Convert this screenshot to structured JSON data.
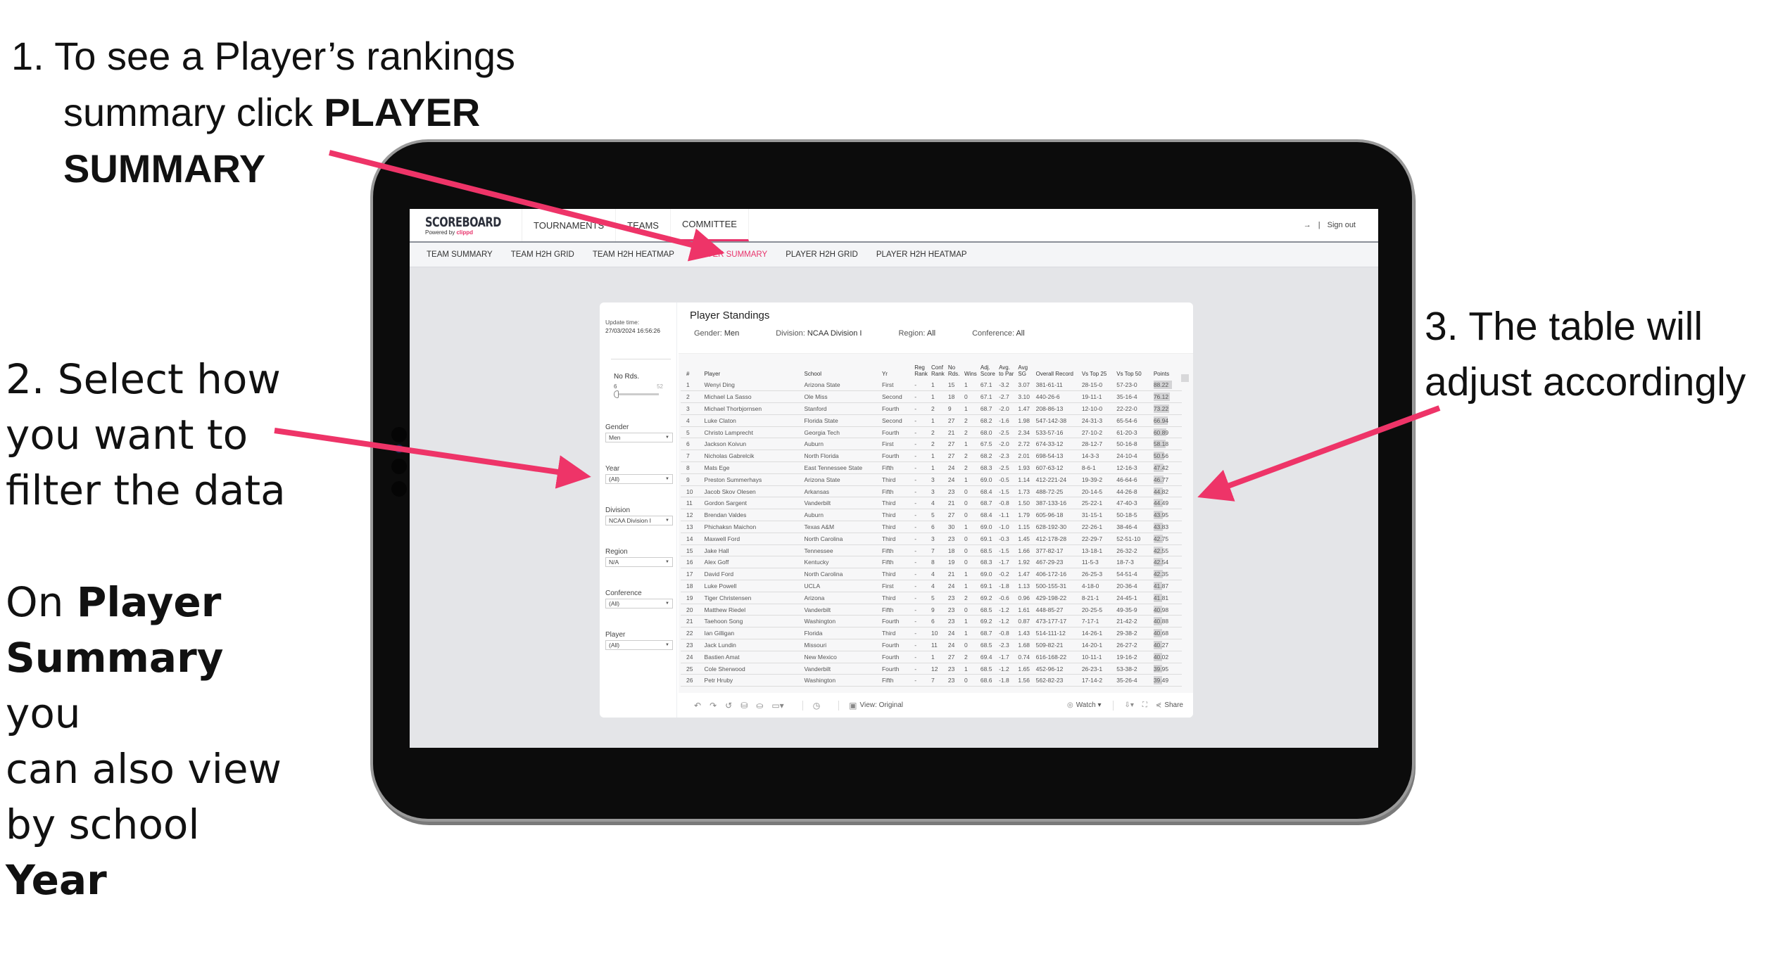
{
  "annotations": {
    "step1": {
      "prefix": "1. To see a Player’s rankings",
      "line2": "summary click ",
      "bold1": "PLAYER",
      "bold2": "SUMMARY"
    },
    "step2": {
      "line1": "2. Select how",
      "line2": "you want to",
      "line3": "filter the data",
      "p1": "On ",
      "b1": "Player",
      "b2": "Summary",
      "p2": " you",
      "line6": "can also view",
      "p3": "by school ",
      "b3": "Year"
    },
    "step3": {
      "line1": "3. The table will",
      "line2": "adjust accordingly"
    },
    "arrow_color": "#ee3468"
  },
  "app": {
    "brand": {
      "title": "SCOREBOARD",
      "sub_prefix": "Powered by ",
      "sub_brand": "clippd"
    },
    "topnav": [
      "TOURNAMENTS",
      "TEAMS",
      "COMMITTEE"
    ],
    "topnav_right": {
      "icon": "→",
      "sep": "|",
      "signout": "Sign out"
    },
    "subnav": [
      "TEAM SUMMARY",
      "TEAM H2H GRID",
      "TEAM H2H HEATMAP",
      "PLAYER SUMMARY",
      "PLAYER H2H GRID",
      "PLAYER H2H HEATMAP"
    ],
    "subnav_active": "PLAYER SUMMARY",
    "accent_color": "#e8336b"
  },
  "sidebar": {
    "update_label": "Update time:",
    "update_value": "27/03/2024 16:56:26",
    "slider": {
      "label": "No Rds.",
      "min": "6",
      "max": "52",
      "value_fraction": 0.0
    },
    "filters": [
      {
        "label": "Gender",
        "value": "Men"
      },
      {
        "label": "Year",
        "value": "(All)"
      },
      {
        "label": "Division",
        "value": "NCAA Division I"
      },
      {
        "label": "Region",
        "value": "N/A"
      },
      {
        "label": "Conference",
        "value": "(All)"
      },
      {
        "label": "Player",
        "value": "(All)"
      }
    ]
  },
  "main": {
    "title": "Player Standings",
    "summary": [
      {
        "key": "Gender: ",
        "value": "Men"
      },
      {
        "key": "Division: ",
        "value": "NCAA Division I"
      },
      {
        "key": "Region: ",
        "value": "All"
      },
      {
        "key": "Conference: ",
        "value": "All"
      }
    ],
    "columns": [
      "#",
      "Player",
      "School",
      "Yr",
      "Reg Rank",
      "Conf Rank",
      "No Rds.",
      "Wins",
      "Adj. Score",
      "Avg. to Par",
      "Avg SG",
      "Overall Record",
      "Vs Top 25",
      "Vs Top 50",
      "Points"
    ],
    "rows": [
      [
        "1",
        "Wenyi Ding",
        "Arizona State",
        "First",
        "-",
        "1",
        "15",
        "1",
        "67.1",
        "-3.2",
        "3.07",
        "381-61-11",
        "28-15-0",
        "57-23-0",
        "88.22"
      ],
      [
        "2",
        "Michael La Sasso",
        "Ole Miss",
        "Second",
        "-",
        "1",
        "18",
        "0",
        "67.1",
        "-2.7",
        "3.10",
        "440-26-6",
        "19-11-1",
        "35-16-4",
        "76.12"
      ],
      [
        "3",
        "Michael Thorbjornsen",
        "Stanford",
        "Fourth",
        "-",
        "2",
        "9",
        "1",
        "68.7",
        "-2.0",
        "1.47",
        "208-86-13",
        "12-10-0",
        "22-22-0",
        "73.22"
      ],
      [
        "4",
        "Luke Claton",
        "Florida State",
        "Second",
        "-",
        "1",
        "27",
        "2",
        "68.2",
        "-1.6",
        "1.98",
        "547-142-38",
        "24-31-3",
        "65-54-6",
        "66.94"
      ],
      [
        "5",
        "Christo Lamprecht",
        "Georgia Tech",
        "Fourth",
        "-",
        "2",
        "21",
        "2",
        "68.0",
        "-2.5",
        "2.34",
        "533-57-16",
        "27-10-2",
        "61-20-3",
        "60.89"
      ],
      [
        "6",
        "Jackson Koivun",
        "Auburn",
        "First",
        "-",
        "2",
        "27",
        "1",
        "67.5",
        "-2.0",
        "2.72",
        "674-33-12",
        "28-12-7",
        "50-16-8",
        "58.18"
      ],
      [
        "7",
        "Nicholas Gabrelcik",
        "North Florida",
        "Fourth",
        "-",
        "1",
        "27",
        "2",
        "68.2",
        "-2.3",
        "2.01",
        "698-54-13",
        "14-3-3",
        "24-10-4",
        "50.56"
      ],
      [
        "8",
        "Mats Ege",
        "East Tennessee State",
        "Fifth",
        "-",
        "1",
        "24",
        "2",
        "68.3",
        "-2.5",
        "1.93",
        "607-63-12",
        "8-6-1",
        "12-16-3",
        "47.42"
      ],
      [
        "9",
        "Preston Summerhays",
        "Arizona State",
        "Third",
        "-",
        "3",
        "24",
        "1",
        "69.0",
        "-0.5",
        "1.14",
        "412-221-24",
        "19-39-2",
        "46-64-6",
        "46.77"
      ],
      [
        "10",
        "Jacob Skov Olesen",
        "Arkansas",
        "Fifth",
        "-",
        "3",
        "23",
        "0",
        "68.4",
        "-1.5",
        "1.73",
        "488-72-25",
        "20-14-5",
        "44-26-8",
        "44.82"
      ],
      [
        "11",
        "Gordon Sargent",
        "Vanderbilt",
        "Third",
        "-",
        "4",
        "21",
        "0",
        "68.7",
        "-0.8",
        "1.50",
        "387-133-16",
        "25-22-1",
        "47-40-3",
        "44.49"
      ],
      [
        "12",
        "Brendan Valdes",
        "Auburn",
        "Third",
        "-",
        "5",
        "27",
        "0",
        "68.4",
        "-1.1",
        "1.79",
        "605-96-18",
        "31-15-1",
        "50-18-5",
        "43.95"
      ],
      [
        "13",
        "Phichaksn Maichon",
        "Texas A&M",
        "Third",
        "-",
        "6",
        "30",
        "1",
        "69.0",
        "-1.0",
        "1.15",
        "628-192-30",
        "22-26-1",
        "38-46-4",
        "43.83"
      ],
      [
        "14",
        "Maxwell Ford",
        "North Carolina",
        "Third",
        "-",
        "3",
        "23",
        "0",
        "69.1",
        "-0.3",
        "1.45",
        "412-178-28",
        "22-29-7",
        "52-51-10",
        "42.75"
      ],
      [
        "15",
        "Jake Hall",
        "Tennessee",
        "Fifth",
        "-",
        "7",
        "18",
        "0",
        "68.5",
        "-1.5",
        "1.66",
        "377-82-17",
        "13-18-1",
        "26-32-2",
        "42.55"
      ],
      [
        "16",
        "Alex Goff",
        "Kentucky",
        "Fifth",
        "-",
        "8",
        "19",
        "0",
        "68.3",
        "-1.7",
        "1.92",
        "467-29-23",
        "11-5-3",
        "18-7-3",
        "42.54"
      ],
      [
        "17",
        "David Ford",
        "North Carolina",
        "Third",
        "-",
        "4",
        "21",
        "1",
        "69.0",
        "-0.2",
        "1.47",
        "406-172-16",
        "26-25-3",
        "54-51-4",
        "42.35"
      ],
      [
        "18",
        "Luke Powell",
        "UCLA",
        "First",
        "-",
        "4",
        "24",
        "1",
        "69.1",
        "-1.8",
        "1.13",
        "500-155-31",
        "4-18-0",
        "20-36-4",
        "41.87"
      ],
      [
        "19",
        "Tiger Christensen",
        "Arizona",
        "Third",
        "-",
        "5",
        "23",
        "2",
        "69.2",
        "-0.6",
        "0.96",
        "429-198-22",
        "8-21-1",
        "24-45-1",
        "41.81"
      ],
      [
        "20",
        "Matthew Riedel",
        "Vanderbilt",
        "Fifth",
        "-",
        "9",
        "23",
        "0",
        "68.5",
        "-1.2",
        "1.61",
        "448-85-27",
        "20-25-5",
        "49-35-9",
        "40.98"
      ],
      [
        "21",
        "Taehoon Song",
        "Washington",
        "Fourth",
        "-",
        "6",
        "23",
        "1",
        "69.2",
        "-1.2",
        "0.87",
        "473-177-17",
        "7-17-1",
        "21-42-2",
        "40.88"
      ],
      [
        "22",
        "Ian Gilligan",
        "Florida",
        "Third",
        "-",
        "10",
        "24",
        "1",
        "68.7",
        "-0.8",
        "1.43",
        "514-111-12",
        "14-26-1",
        "29-38-2",
        "40.68"
      ],
      [
        "23",
        "Jack Lundin",
        "Missouri",
        "Fourth",
        "-",
        "11",
        "24",
        "0",
        "68.5",
        "-2.3",
        "1.68",
        "509-82-21",
        "14-20-1",
        "26-27-2",
        "40.27"
      ],
      [
        "24",
        "Bastien Amat",
        "New Mexico",
        "Fourth",
        "-",
        "1",
        "27",
        "2",
        "69.4",
        "-1.7",
        "0.74",
        "616-168-22",
        "10-11-1",
        "19-16-2",
        "40.02"
      ],
      [
        "25",
        "Cole Sherwood",
        "Vanderbilt",
        "Fourth",
        "-",
        "12",
        "23",
        "1",
        "68.5",
        "-1.2",
        "1.65",
        "452-96-12",
        "26-23-1",
        "53-38-2",
        "39.95"
      ],
      [
        "26",
        "Petr Hruby",
        "Washington",
        "Fifth",
        "-",
        "7",
        "23",
        "0",
        "68.6",
        "-1.8",
        "1.56",
        "562-82-23",
        "17-14-2",
        "35-26-4",
        "39.49"
      ]
    ]
  },
  "toolbar": {
    "left_icons": [
      "undo-icon",
      "redo-icon",
      "revert-icon",
      "refresh-data-icon",
      "pause-data-icon",
      "highlight-icon"
    ],
    "speed_icon": "speed-icon",
    "view_label": "View: Original",
    "watch_label": "Watch ▾",
    "download_icon": "download-icon",
    "fullscreen_icon": "fullscreen-icon",
    "share_label": "Share"
  }
}
